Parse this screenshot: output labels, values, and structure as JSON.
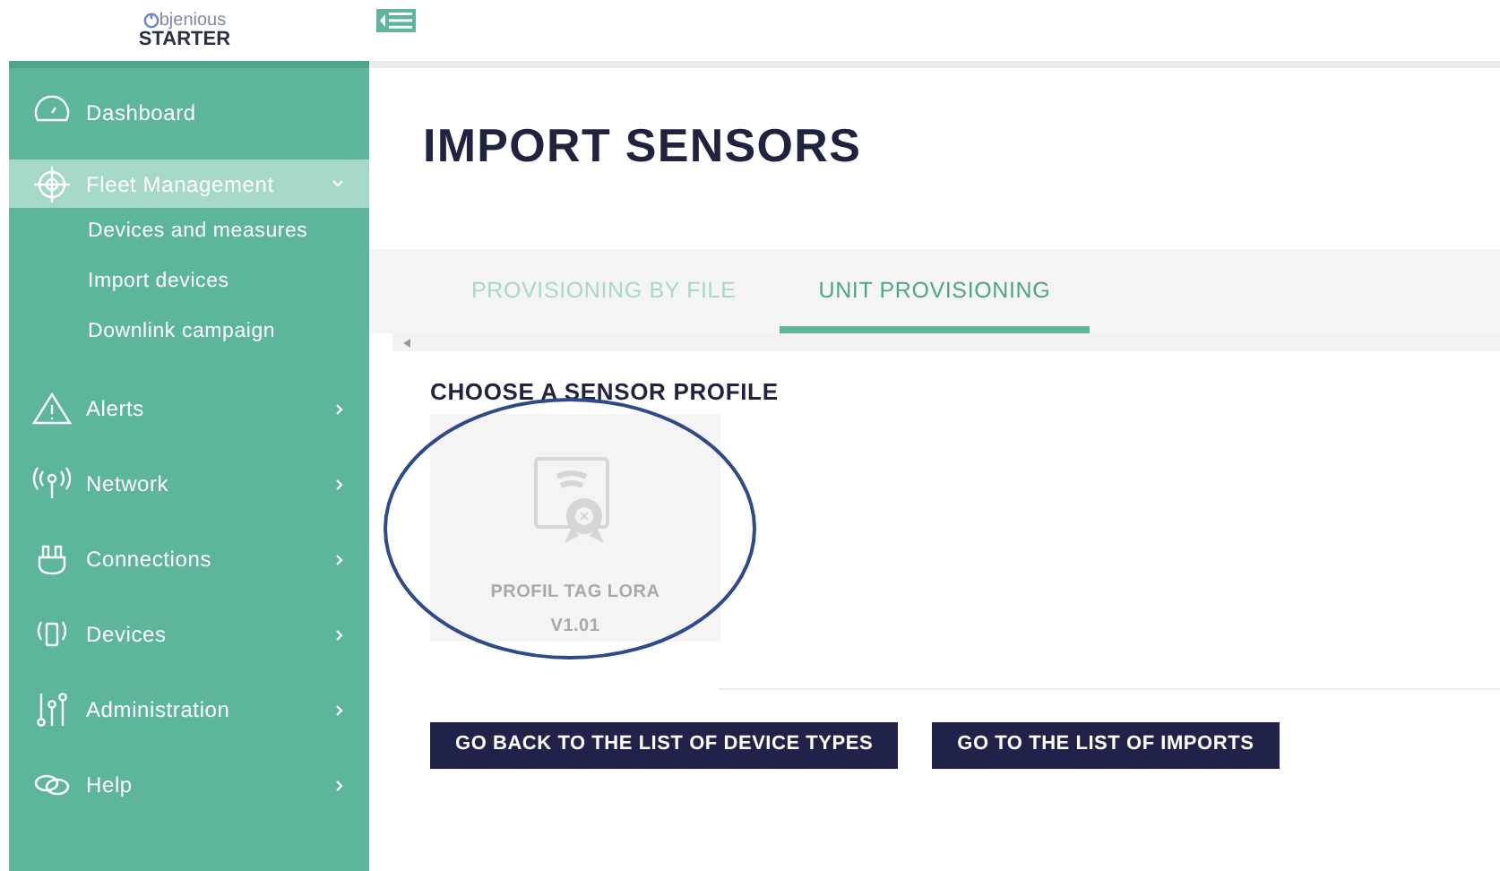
{
  "logo": {
    "brand": "bjenious",
    "edition": "STARTER"
  },
  "sidebar": {
    "items": [
      {
        "label": "Dashboard",
        "selected": false
      },
      {
        "label": "Fleet Management",
        "selected": true,
        "expanded": true,
        "children": [
          {
            "label": "Devices and measures"
          },
          {
            "label": "Import devices"
          },
          {
            "label": "Downlink campaign"
          }
        ]
      },
      {
        "label": "Alerts",
        "selected": false,
        "expanded": false
      },
      {
        "label": "Network",
        "selected": false,
        "expanded": false
      },
      {
        "label": "Connections",
        "selected": false,
        "expanded": false
      },
      {
        "label": "Devices",
        "selected": false,
        "expanded": false
      },
      {
        "label": "Administration",
        "selected": false,
        "expanded": false
      },
      {
        "label": "Help",
        "selected": false,
        "expanded": false
      }
    ]
  },
  "page_title": "IMPORT SENSORS",
  "tabs": [
    {
      "label": "PROVISIONING BY FILE",
      "selected": false
    },
    {
      "label": "UNIT PROVISIONING",
      "selected": true
    }
  ],
  "section_title": "CHOOSE A SENSOR PROFILE",
  "profiles": [
    {
      "name": "PROFIL TAG LORA",
      "version": "V1.01",
      "disabled": true
    }
  ],
  "buttons": [
    "GO BACK TO THE LIST OF DEVICE TYPES",
    "GO TO THE LIST OF IMPORTS"
  ],
  "annotation": {
    "kind": "ellipse"
  }
}
